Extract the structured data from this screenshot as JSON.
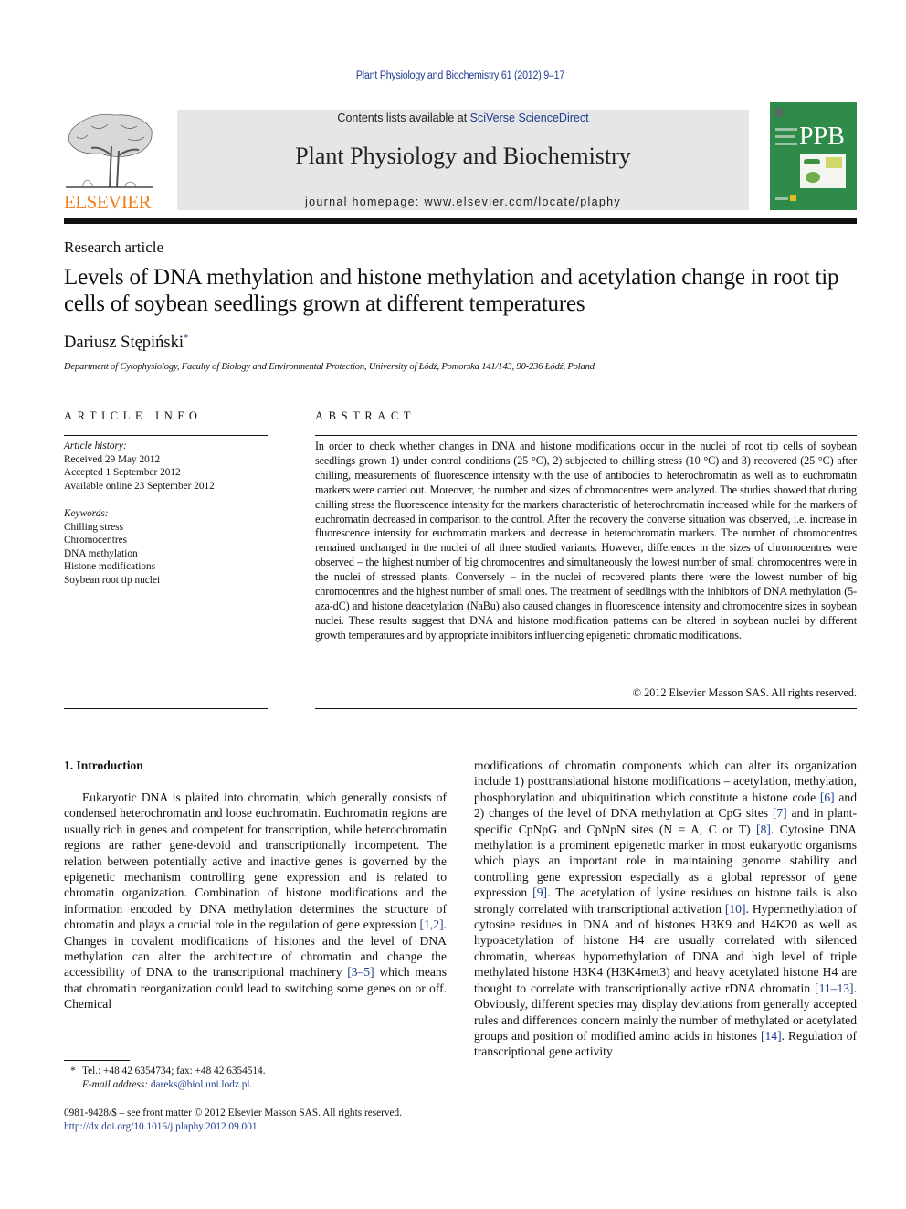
{
  "header": {
    "journal_citation": "Plant Physiology and Biochemistry 61 (2012) 9–17",
    "contents_prefix": "Contents lists available at ",
    "contents_link": "SciVerse ScienceDirect",
    "journal_name": "Plant Physiology and Biochemistry",
    "homepage_prefix": "journal homepage: ",
    "homepage_url": "www.elsevier.com/locate/plaphy",
    "publisher_logo_text": "ELSEVIER",
    "cover_abbrev": "PPB"
  },
  "colors": {
    "link": "#1f3b8f",
    "elsevier_orange": "#f07f1a",
    "cover_green": "#2e8b4a",
    "banner_gray": "#e6e6e6"
  },
  "article": {
    "type": "Research article",
    "title": "Levels of DNA methylation and histone methylation and acetylation change in root tip cells of soybean seedlings grown at different temperatures",
    "author": "Dariusz Stępiński",
    "author_mark": "*",
    "affiliation": "Department of Cytophysiology, Faculty of Biology and Environmental Protection, University of Łódź, Pomorska 141/143, 90-236 Łódź, Poland"
  },
  "article_info": {
    "heading": "ARTICLE INFO",
    "history_label": "Article history:",
    "history": [
      "Received 29 May 2012",
      "Accepted 1 September 2012",
      "Available online 23 September 2012"
    ],
    "keywords_label": "Keywords:",
    "keywords": [
      "Chilling stress",
      "Chromocentres",
      "DNA methylation",
      "Histone modifications",
      "Soybean root tip nuclei"
    ]
  },
  "abstract": {
    "heading": "ABSTRACT",
    "text": "In order to check whether changes in DNA and histone modifications occur in the nuclei of root tip cells of soybean seedlings grown 1) under control conditions (25 °C), 2) subjected to chilling stress (10 °C) and 3) recovered (25 °C) after chilling, measurements of fluorescence intensity with the use of antibodies to heterochromatin as well as to euchromatin markers were carried out. Moreover, the number and sizes of chromocentres were analyzed. The studies showed that during chilling stress the fluorescence intensity for the markers characteristic of heterochromatin increased while for the markers of euchromatin decreased in comparison to the control. After the recovery the converse situation was observed, i.e. increase in fluorescence intensity for euchromatin markers and decrease in heterochromatin markers. The number of chromocentres remained unchanged in the nuclei of all three studied variants. However, differences in the sizes of chromocentres were observed – the highest number of big chromocentres and simultaneously the lowest number of small chromocentres were in the nuclei of stressed plants. Conversely – in the nuclei of recovered plants there were the lowest number of big chromocentres and the highest number of small ones. The treatment of seedlings with the inhibitors of DNA methylation (5-aza-dC) and histone deacetylation (NaBu) also caused changes in fluorescence intensity and chromocentre sizes in soybean nuclei. These results suggest that DNA and histone modification patterns can be altered in soybean nuclei by different growth temperatures and by appropriate inhibitors influencing epigenetic chromatic modifications.",
    "copyright": "© 2012 Elsevier Masson SAS. All rights reserved."
  },
  "intro": {
    "heading": "1.  Introduction",
    "left": [
      {
        "t": "Eukaryotic DNA is plaited into chromatin, which generally consists of condensed heterochromatin and loose euchromatin. Euchromatin regions are usually rich in genes and competent for transcription, while heterochromatin regions are rather gene-devoid and transcriptionally incompetent. The relation between potentially active and inactive genes is governed by the epigenetic mechanism controlling gene expression and is related to chromatin organization. Combination of histone modifications and the information encoded by DNA methylation determines the structure of chromatin and plays a crucial role in the regulation of gene expression "
      },
      {
        "ref": "[1,2]"
      },
      {
        "t": ". Changes in covalent modifications of histones and the level of DNA methylation can alter the architecture of chromatin and change the accessibility of DNA to the transcriptional machinery "
      },
      {
        "ref": "[3–5]"
      },
      {
        "t": " which means that chromatin reorganization could lead to switching some genes on or off. Chemical"
      }
    ],
    "right": [
      {
        "t": "modifications of chromatin components which can alter its organization include 1) posttranslational histone modifications – acetylation, methylation, phosphorylation and ubiquitination which constitute a histone code "
      },
      {
        "ref": "[6]"
      },
      {
        "t": " and 2) changes of the level of DNA methylation at CpG sites "
      },
      {
        "ref": "[7]"
      },
      {
        "t": " and in plant-specific CpNpG and CpNpN sites (N = A, C or T) "
      },
      {
        "ref": "[8]"
      },
      {
        "t": ". Cytosine DNA methylation is a prominent epigenetic marker in most eukaryotic organisms which plays an important role in maintaining genome stability and controlling gene expression especially as a global repressor of gene expression "
      },
      {
        "ref": "[9]"
      },
      {
        "t": ". The acetylation of lysine residues on histone tails is also strongly correlated with transcriptional activation "
      },
      {
        "ref": "[10]"
      },
      {
        "t": ". Hypermethylation of cytosine residues in DNA and of histones H3K9 and H4K20 as well as hypoacetylation of histone H4 are usually correlated with silenced chromatin, whereas hypomethylation of DNA and high level of triple methylated histone H3K4 (H3K4met3) and heavy acetylated histone H4 are thought to correlate with transcriptionally active rDNA chromatin "
      },
      {
        "ref": "[11–13]"
      },
      {
        "t": ". Obviously, different species may display deviations from generally accepted rules and differences concern mainly the number of methylated or acetylated groups and position of modified amino acids in histones "
      },
      {
        "ref": "[14]"
      },
      {
        "t": ". Regulation of transcriptional gene activity"
      }
    ]
  },
  "footnote": {
    "mark": "*",
    "contact": "Tel.: +48 42 6354734; fax: +48 42 6354514.",
    "email_label": "E-mail address: ",
    "email": "dareks@biol.uni.lodz.pl",
    "email_end": "."
  },
  "front_matter": {
    "issn_line": "0981-9428/$ – see front matter © 2012 Elsevier Masson SAS. All rights reserved.",
    "doi": "http://dx.doi.org/10.1016/j.plaphy.2012.09.001"
  }
}
